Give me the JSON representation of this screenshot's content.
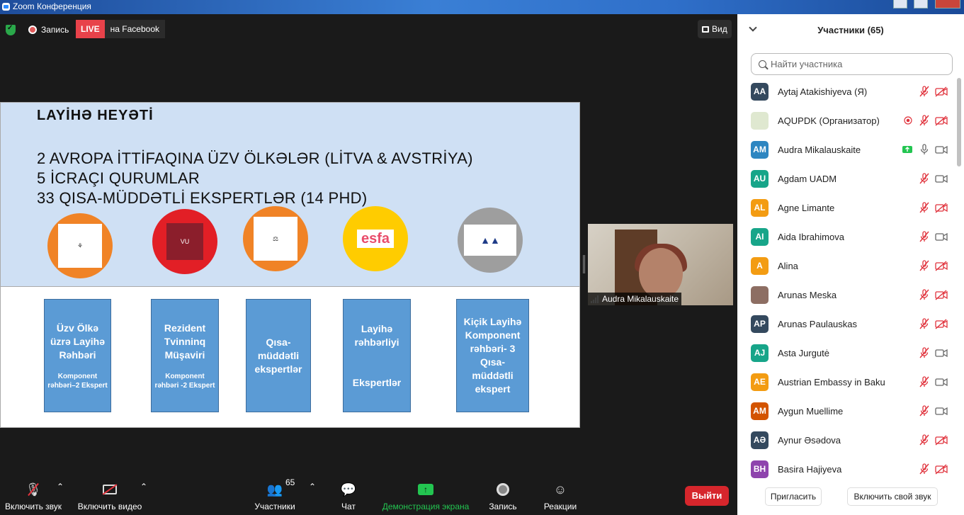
{
  "window": {
    "title": "Zoom Конференция"
  },
  "topbar": {
    "record_label": "Запись",
    "live_label": "LIVE",
    "live_dest": "на Facebook",
    "view_label": "Вид"
  },
  "slide": {
    "heading": "LAYİHƏ HEYƏTİ",
    "lines": [
      "2 AVROPA İTTİFAQINA  ÜZV ÖLKƏLƏR (LİTVA & AVSTRİYA)",
      "5 İCRAÇI QURUMLAR",
      "33  QISA-MÜDDƏTLİ EKSPERTLƏR (14 PHD)"
    ],
    "logos": [
      {
        "name": "org-logo-1",
        "color": "#f08326"
      },
      {
        "name": "vilnius-university-logo",
        "color": "#e21f26"
      },
      {
        "name": "org-logo-3",
        "color": "#f08326"
      },
      {
        "name": "esfa-logo",
        "color": "#ffcc00",
        "text": "esfa"
      },
      {
        "name": "ludwig-boltzmann-logo",
        "color": "#9e9e9e"
      }
    ],
    "boxes": [
      {
        "title": "Üzv Ölkə üzrə Layihə Rəhbəri",
        "sub": "Komponent rəhbəri–2 Ekspert"
      },
      {
        "title": "Rezident Tvinninq Müşaviri",
        "sub": "Komponent rəhbəri -2 Ekspert"
      },
      {
        "title": "Qısa-müddətli ekspertlər",
        "sub": ""
      },
      {
        "title": "Layihə rəhbərliyi",
        "sub": "Ekspertlər"
      },
      {
        "title": "Kiçik Layihə Komponent rəhbəri- 3 Qısa-müddətli ekspert",
        "sub": ""
      }
    ]
  },
  "video": {
    "name": "Audra Mikalauskaite"
  },
  "toolbar": {
    "unmute": "Включить звук",
    "start_video": "Включить видео",
    "participants": "Участники",
    "participants_count": "65",
    "chat": "Чат",
    "share": "Демонстрация экрана",
    "record": "Запись",
    "reactions": "Реакции",
    "end": "Выйти"
  },
  "panel": {
    "title": "Участники (65)",
    "search_placeholder": "Найти участника",
    "invite": "Пригласить",
    "unmute_me": "Включить свой звук",
    "participants": [
      {
        "initials": "AA",
        "name": "Aytaj Atakishiyeva (Я)",
        "color": "#34495e",
        "video": "off",
        "mic": "muted"
      },
      {
        "initials": "",
        "name": "AQUPDK (Организатор)",
        "color": "#dfe8d0",
        "video": "off",
        "mic": "muted",
        "recording": true
      },
      {
        "initials": "AM",
        "name": "Audra Mikalauskaite",
        "color": "#2e86c1",
        "video": "on",
        "mic": "on",
        "sharing": true
      },
      {
        "initials": "AU",
        "name": "Agdam UADM",
        "color": "#17a589",
        "video": "on",
        "mic": "muted"
      },
      {
        "initials": "AL",
        "name": "Agne Limante",
        "color": "#f39c12",
        "video": "off",
        "mic": "muted"
      },
      {
        "initials": "AI",
        "name": "Aida Ibrahimova",
        "color": "#17a589",
        "video": "on",
        "mic": "muted"
      },
      {
        "initials": "A",
        "name": "Alina",
        "color": "#f39c12",
        "video": "off",
        "mic": "muted"
      },
      {
        "initials": "",
        "name": "Arunas Meska",
        "color": "#8d6e63",
        "video": "off",
        "mic": "muted"
      },
      {
        "initials": "AP",
        "name": "Arunas Paulauskas",
        "color": "#34495e",
        "video": "off",
        "mic": "muted"
      },
      {
        "initials": "AJ",
        "name": "Asta Jurgutė",
        "color": "#17a589",
        "video": "on",
        "mic": "muted"
      },
      {
        "initials": "AE",
        "name": "Austrian Embassy in Baku",
        "color": "#f39c12",
        "video": "on",
        "mic": "muted"
      },
      {
        "initials": "AM",
        "name": "Aygun Muellime",
        "color": "#d35400",
        "video": "on",
        "mic": "muted"
      },
      {
        "initials": "AƏ",
        "name": "Aynur Əsədova",
        "color": "#34495e",
        "video": "off",
        "mic": "muted"
      },
      {
        "initials": "BH",
        "name": "Basira Hajiyeva",
        "color": "#8e44ad",
        "video": "off",
        "mic": "muted"
      }
    ]
  }
}
